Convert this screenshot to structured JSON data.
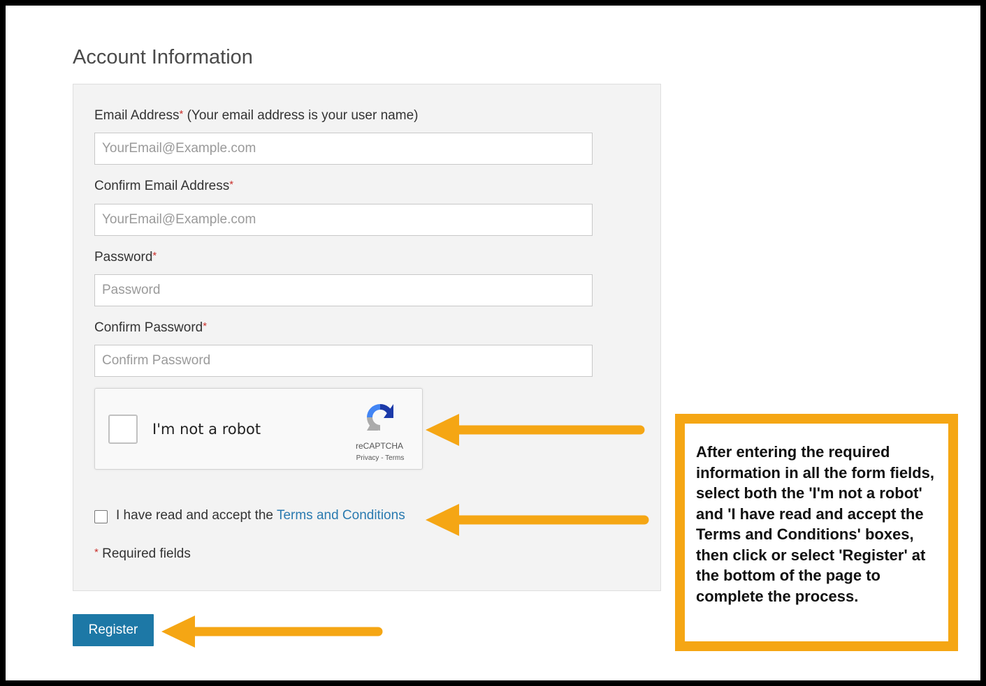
{
  "form": {
    "title": "Account Information",
    "email": {
      "label": "Email Address",
      "required_marker": "*",
      "hint": " (Your email address is your user name)",
      "placeholder": "YourEmail@Example.com"
    },
    "confirm_email": {
      "label": "Confirm Email Address",
      "required_marker": "*",
      "placeholder": "YourEmail@Example.com"
    },
    "password": {
      "label": "Password",
      "required_marker": "*",
      "placeholder": "Password"
    },
    "confirm_password": {
      "label": "Confirm Password",
      "required_marker": "*",
      "placeholder": "Confirm Password"
    },
    "captcha": {
      "label": "I'm not a robot",
      "brand": "reCAPTCHA",
      "privacy": "Privacy",
      "separator": " - ",
      "terms": "Terms",
      "icon": "recaptcha-logo"
    },
    "terms": {
      "prefix": "I have read and accept the ",
      "link": "Terms and Conditions"
    },
    "required_note": {
      "marker": "*",
      "text": " Required fields"
    },
    "register_label": "Register"
  },
  "callout": {
    "text": "After entering the required information in all the form fields, select both the 'I'm not a robot' and 'I have read and accept the Terms and Conditions' boxes, then click or select 'Register' at the bottom of the page to complete the process."
  },
  "colors": {
    "accent": "#f5a614",
    "button": "#1d78a6",
    "link": "#2a7ab0",
    "required": "#c9302c"
  }
}
